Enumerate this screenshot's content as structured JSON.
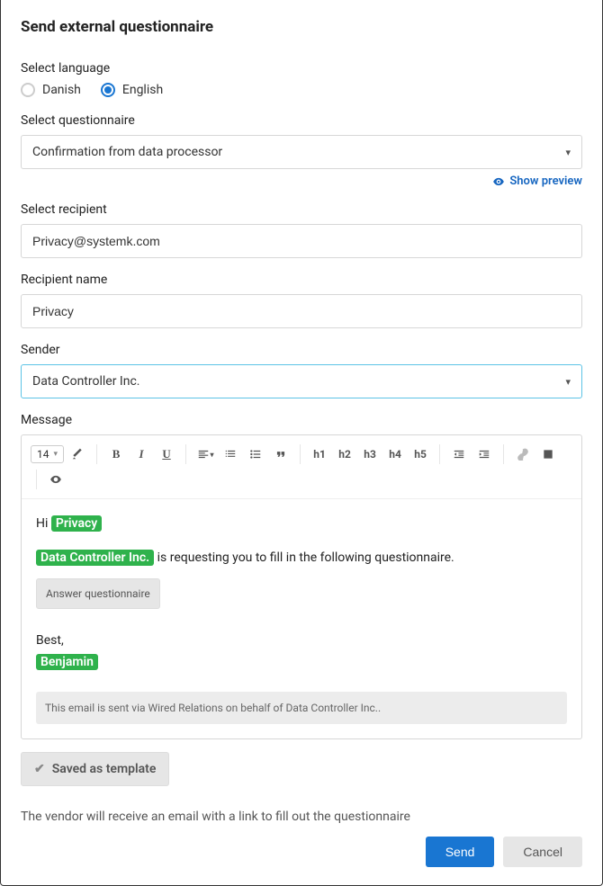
{
  "title": "Send external questionnaire",
  "language": {
    "label": "Select language",
    "options": [
      {
        "label": "Danish",
        "selected": false
      },
      {
        "label": "English",
        "selected": true
      }
    ]
  },
  "questionnaire": {
    "label": "Select questionnaire",
    "value": "Confirmation from data processor"
  },
  "preview_link": "Show preview",
  "recipient": {
    "label": "Select recipient",
    "value": "Privacy@systemk.com"
  },
  "recipient_name": {
    "label": "Recipient name",
    "value": "Privacy"
  },
  "sender": {
    "label": "Sender",
    "value": "Data Controller Inc."
  },
  "message": {
    "label": "Message",
    "font_size": "14",
    "greeting_prefix": "Hi",
    "recipient_tag": "Privacy",
    "sender_tag": "Data Controller Inc.",
    "request_text": "is requesting you to fill in the following questionnaire.",
    "answer_button": "Answer questionnaire",
    "signoff": "Best,",
    "sender_name": "Benjamin",
    "footer": "This email is sent via Wired Relations on behalf of Data Controller Inc.."
  },
  "toolbar": {
    "headings": [
      "h1",
      "h2",
      "h3",
      "h4",
      "h5"
    ]
  },
  "saved_template": "Saved as template",
  "helper": "The vendor will receive an email with a link to fill out the questionnaire",
  "actions": {
    "send": "Send",
    "cancel": "Cancel"
  }
}
